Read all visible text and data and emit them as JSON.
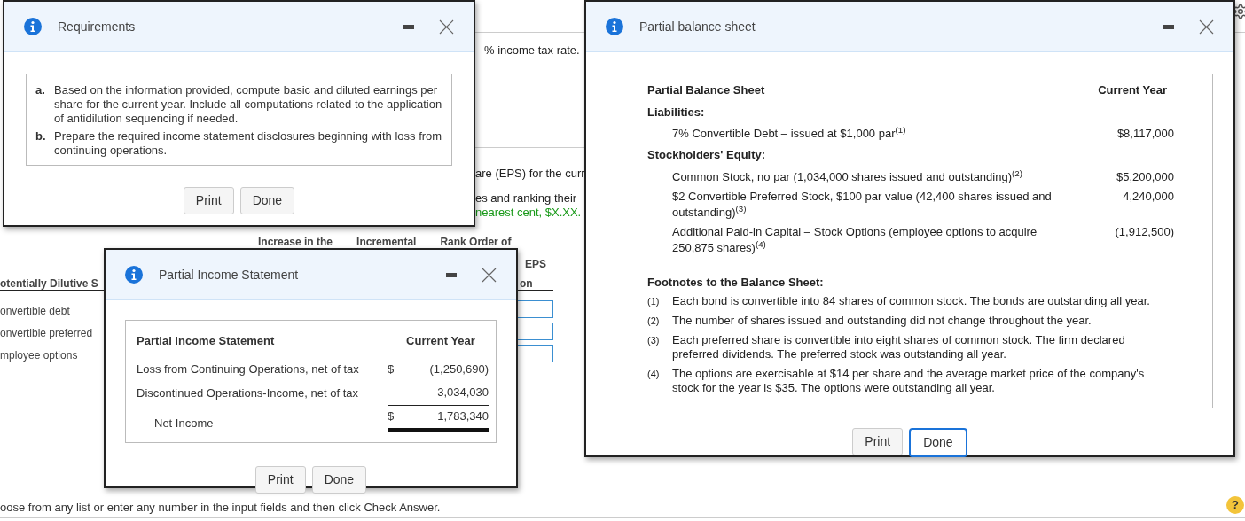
{
  "page": {
    "intro_fragment": "% income tax rate.",
    "question_fragments": [
      "are (EPS) for the curr",
      "es and ranking their"
    ],
    "hint_fragment": "nearest cent, $X.XX.",
    "table": {
      "column_headers": [
        "Increase in the",
        "Incremental",
        "Rank Order of"
      ],
      "header_fragments": [
        "EPS",
        "on"
      ],
      "row_header": "otentially Dilutive S",
      "rows": [
        {
          "label": "onvertible debt"
        },
        {
          "label": "onvertible preferred"
        },
        {
          "label": "mployee options"
        }
      ]
    },
    "footer_instruction": "oose from any list or enter any number in the input fields and then click Check Answer.",
    "help": "?"
  },
  "dialogs": [
    {
      "kind": "requirements",
      "title": "Requirements",
      "items": [
        {
          "marker": "a.",
          "text": "Based on the information provided, compute basic and diluted earnings per share for the current year. Include all computations related to the application of antidilution sequencing if needed."
        },
        {
          "marker": "b.",
          "text": "Prepare the required income statement disclosures beginning with loss from continuing operations."
        }
      ],
      "buttons": [
        {
          "label": "Print",
          "focused": false
        },
        {
          "label": "Done",
          "focused": false
        }
      ]
    },
    {
      "kind": "income",
      "title": "Partial Income Statement",
      "heading": "Partial Income Statement",
      "column": "Current Year",
      "rows": [
        {
          "kind": "line",
          "label": "Loss from Continuing Operations, net of tax",
          "currency": "$",
          "value": "(1,250,690)"
        },
        {
          "kind": "subtotal",
          "label": "Discontinued Operations-Income, net of tax",
          "value": "3,034,030"
        },
        {
          "kind": "total",
          "label": "Net Income",
          "currency": "$",
          "value": "1,783,340"
        }
      ],
      "buttons": [
        {
          "label": "Print",
          "focused": false
        },
        {
          "label": "Done",
          "focused": false
        }
      ]
    },
    {
      "kind": "balance",
      "title": "Partial balance sheet",
      "heading": "Partial Balance Sheet",
      "column": "Current Year",
      "rows": [
        {
          "kind": "section",
          "label": "Liabilities:"
        },
        {
          "kind": "item",
          "label": "7% Convertible Debt – issued at $1,000 par$^{(1)}$",
          "value": "$8,117,000"
        },
        {
          "kind": "section",
          "label": "Stockholders' Equity:"
        },
        {
          "kind": "item",
          "label": "Common Stock, no par (1,034,000 shares issued and outstanding)$^{(2)}$",
          "value": "$5,200,000"
        },
        {
          "kind": "item",
          "label": "$2 Convertible Preferred Stock, $100 par value (42,400 shares issued and outstanding)$^{(3)}$",
          "value": "4,240,000"
        },
        {
          "kind": "item",
          "label": "Additional Paid-in Capital – Stock Options (employee options to acquire 250,875 shares)$^{(4)}$",
          "value": "(1,912,500)"
        }
      ],
      "footnotes_title": "Footnotes to the Balance Sheet:",
      "footnotes": [
        {
          "marker": "(1)",
          "text": "Each bond is convertible into 84 shares of common stock. The bonds are outstanding all year."
        },
        {
          "marker": "(2)",
          "text": "The number of shares issued and outstanding did not change throughout the year."
        },
        {
          "marker": "(3)",
          "text": "Each preferred share is convertible into eight shares of common stock. The firm declared preferred dividends. The preferred stock was outstanding all year."
        },
        {
          "marker": "(4)",
          "text": "The options are exercisable at $14 per share and the average market price of the company's stock for the year is $35. The options were outstanding all year."
        }
      ],
      "buttons": [
        {
          "label": "Print",
          "focused": false
        },
        {
          "label": "Done",
          "focused": true
        }
      ]
    }
  ]
}
